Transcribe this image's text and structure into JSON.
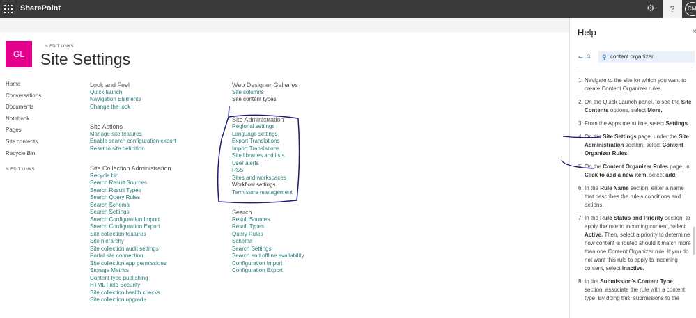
{
  "topbar": {
    "brand": "SharePoint",
    "help_label": "?",
    "avatar": "CM",
    "gear": "⚙"
  },
  "site": {
    "logo": "GL",
    "edit_links": "EDIT LINKS",
    "title": "Site Settings"
  },
  "nav": {
    "items": [
      "Home",
      "Conversations",
      "Documents",
      "Notebook",
      "Pages",
      "Site contents",
      "Recycle Bin"
    ],
    "edit_links": "EDIT LINKS"
  },
  "sections": [
    {
      "heading": "Look and Feel",
      "links": [
        "Quick launch",
        "Navigation Elements",
        "Change the look"
      ]
    },
    {
      "heading": "Site Actions",
      "links": [
        "Manage site features",
        "Enable search configuration export",
        "Reset to site definition"
      ]
    },
    {
      "heading": "Site Collection Administration",
      "links": [
        "Recycle bin",
        "Search Result Sources",
        "Search Result Types",
        "Search Query Rules",
        "Search Schema",
        "Search Settings",
        "Search Configuration Import",
        "Search Configuration Export",
        "Site collection features",
        "Site hierarchy",
        "Site collection audit settings",
        "Portal site connection",
        "Site collection app permissions",
        "Storage Metrics",
        "Content type publishing",
        "HTML Field Security",
        "Site collection health checks",
        "Site collection upgrade"
      ]
    },
    {
      "heading": "Web Designer Galleries",
      "links": [
        "Site columns",
        "Site content types"
      ]
    },
    {
      "heading": "Site Administration",
      "links": [
        "Regional settings",
        "Language settings",
        "Export Translations",
        "Import Translations",
        "Site libraries and lists",
        "User alerts",
        "RSS",
        "Sites and workspaces",
        "Workflow settings",
        "Term store management"
      ]
    },
    {
      "heading": "Search",
      "links": [
        "Result Sources",
        "Result Types",
        "Query Rules",
        "Schema",
        "Search Settings",
        "Search and offline availability",
        "Configuration Import",
        "Configuration Export"
      ]
    }
  ],
  "help": {
    "title": "Help",
    "close": "×",
    "back": "←",
    "home": "⌂",
    "search_icon": "⚲",
    "search_value": "content organizer",
    "steps": [
      {
        "n": "1.",
        "parts": [
          {
            "t": "Navigate to the site for which you want to create Content Organizer rules."
          }
        ]
      },
      {
        "n": "2.",
        "parts": [
          {
            "t": "On the Quick Launch panel, to see the "
          },
          {
            "t": "Site Contents",
            "b": true
          },
          {
            "t": " options, select "
          },
          {
            "t": "More.",
            "b": true
          }
        ]
      },
      {
        "n": "3.",
        "parts": [
          {
            "t": "From the Apps menu line, select "
          },
          {
            "t": "Settings.",
            "b": true
          }
        ]
      },
      {
        "n": "4.",
        "parts": [
          {
            "t": "On the "
          },
          {
            "t": "Site Settings",
            "b": true
          },
          {
            "t": " page, under the "
          },
          {
            "t": "Site Administration",
            "b": true
          },
          {
            "t": " section, select "
          },
          {
            "t": "Content Organizer Rules.",
            "b": true
          }
        ]
      },
      {
        "n": "5.",
        "parts": [
          {
            "t": "On the "
          },
          {
            "t": "Content Organizer Rules",
            "b": true
          },
          {
            "t": " page, in "
          },
          {
            "t": "Click to add a new item",
            "b": true
          },
          {
            "t": ", select "
          },
          {
            "t": "add.",
            "b": true
          }
        ]
      },
      {
        "n": "6.",
        "parts": [
          {
            "t": "In the "
          },
          {
            "t": "Rule Name",
            "b": true
          },
          {
            "t": " section, enter a name that describes the rule's conditions and actions."
          }
        ]
      },
      {
        "n": "7.",
        "parts": [
          {
            "t": "In the "
          },
          {
            "t": "Rule Status and Priority",
            "b": true
          },
          {
            "t": " section, to apply the rule to incoming content, select "
          },
          {
            "t": "Active.",
            "b": true
          },
          {
            "t": " Then, select a priority to determine how content is routed should it match more than one Content Organizer rule. If you do not want this rule to apply to incoming content, select "
          },
          {
            "t": "Inactive.",
            "b": true
          }
        ]
      },
      {
        "n": "8.",
        "parts": [
          {
            "t": "In the "
          },
          {
            "t": "Submission's Content Type",
            "b": true
          },
          {
            "t": " section, associate the rule with a content type. By doing this, submissions to the"
          }
        ]
      }
    ]
  }
}
